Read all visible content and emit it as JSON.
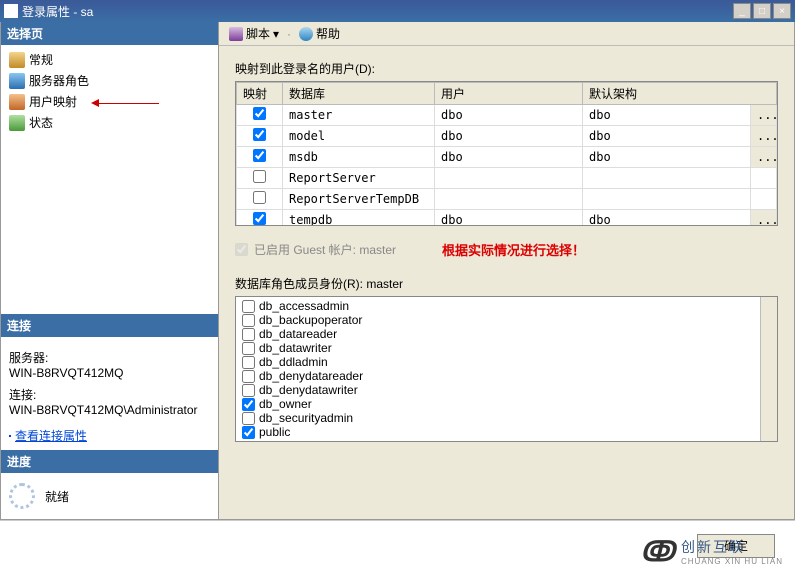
{
  "window": {
    "title": "登录属性 - sa"
  },
  "sidebar": {
    "select_page_header": "选择页",
    "items": [
      {
        "label": "常规"
      },
      {
        "label": "服务器角色"
      },
      {
        "label": "用户映射"
      },
      {
        "label": "状态"
      }
    ],
    "connection_header": "连接",
    "server_label": "服务器:",
    "server_value": "WIN-B8RVQT412MQ",
    "conn_label": "连接:",
    "conn_value": "WIN-B8RVQT412MQ\\Administrator",
    "view_conn_link": "查看连接属性",
    "progress_header": "进度",
    "progress_status": "就绪"
  },
  "toolbar": {
    "script_label": "脚本",
    "help_label": "帮助"
  },
  "main": {
    "mapping_label": "映射到此登录名的用户(D):",
    "grid_headers": {
      "map": "映射",
      "db": "数据库",
      "user": "用户",
      "schema": "默认架构"
    },
    "rows": [
      {
        "checked": true,
        "db": "master",
        "user": "dbo",
        "schema": "dbo",
        "ell": true
      },
      {
        "checked": true,
        "db": "model",
        "user": "dbo",
        "schema": "dbo",
        "ell": true
      },
      {
        "checked": true,
        "db": "msdb",
        "user": "dbo",
        "schema": "dbo",
        "ell": true
      },
      {
        "checked": false,
        "db": "ReportServer",
        "user": "",
        "schema": "",
        "ell": false
      },
      {
        "checked": false,
        "db": "ReportServerTempDB",
        "user": "",
        "schema": "",
        "ell": false
      },
      {
        "checked": true,
        "db": "tempdb",
        "user": "dbo",
        "schema": "dbo",
        "ell": true
      }
    ],
    "guest_label": "已启用 Guest 帐户: master",
    "red_note": "根据实际情况进行选择！",
    "roles_label": "数据库角色成员身份(R): master",
    "roles": [
      {
        "checked": false,
        "name": "db_accessadmin"
      },
      {
        "checked": false,
        "name": "db_backupoperator"
      },
      {
        "checked": false,
        "name": "db_datareader"
      },
      {
        "checked": false,
        "name": "db_datawriter"
      },
      {
        "checked": false,
        "name": "db_ddladmin"
      },
      {
        "checked": false,
        "name": "db_denydatareader"
      },
      {
        "checked": false,
        "name": "db_denydatawriter"
      },
      {
        "checked": true,
        "name": "db_owner"
      },
      {
        "checked": false,
        "name": "db_securityadmin"
      },
      {
        "checked": true,
        "name": "public"
      }
    ]
  },
  "footer": {
    "ok": "确定"
  },
  "branding": {
    "name": "创新互联",
    "sub": "CHUANG XIN HU LIAN"
  },
  "ellipsis": "..."
}
